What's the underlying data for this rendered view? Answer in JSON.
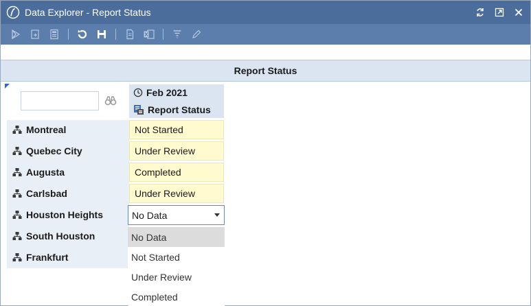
{
  "window": {
    "title": "Data Explorer - Report Status",
    "title_bar_color": "#4a6d9c",
    "toolbar_color": "#5b7eac"
  },
  "toolbar": {
    "icons": [
      "run-icon",
      "export-icon",
      "calculator-icon",
      "refresh-icon",
      "save-icon",
      "document-icon",
      "excel-icon",
      "filter-icon",
      "edit-icon"
    ]
  },
  "header": {
    "title": "Report Status"
  },
  "search": {
    "value": "",
    "placeholder": ""
  },
  "columns": {
    "period": "Feb 2021",
    "measure": "Report Status"
  },
  "rows": [
    {
      "label": "Montreal",
      "status": "Not Started"
    },
    {
      "label": "Quebec City",
      "status": "Under Review"
    },
    {
      "label": "Augusta",
      "status": "Completed"
    },
    {
      "label": "Carlsbad",
      "status": "Under Review"
    },
    {
      "label": "Houston Heights",
      "status": "No Data"
    },
    {
      "label": "South Houston",
      "status": ""
    },
    {
      "label": "Frankfurt",
      "status": ""
    }
  ],
  "dropdown": {
    "selected": "No Data",
    "options": [
      "No Data",
      "Not Started",
      "Under Review",
      "Completed"
    ]
  },
  "colors": {
    "cell_fill": "#fffbcf",
    "header_fill": "#dae5f1",
    "row_header_fill": "#e9eff7",
    "option_highlight": "#dcdcdc"
  }
}
